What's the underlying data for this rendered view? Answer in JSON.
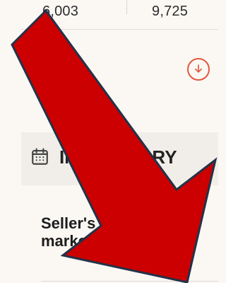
{
  "stats": {
    "left_value": "6,003",
    "right_value": "9,725"
  },
  "download": {
    "icon": "download-icon"
  },
  "section": {
    "icon": "calendar-icon",
    "title": "IN SUMMARY"
  },
  "market": {
    "text": "Seller's\nmarket"
  },
  "overlay": {
    "icon": "arrow-down-right-icon",
    "fill_color": "#cc0000",
    "stroke_color": "#233248"
  }
}
